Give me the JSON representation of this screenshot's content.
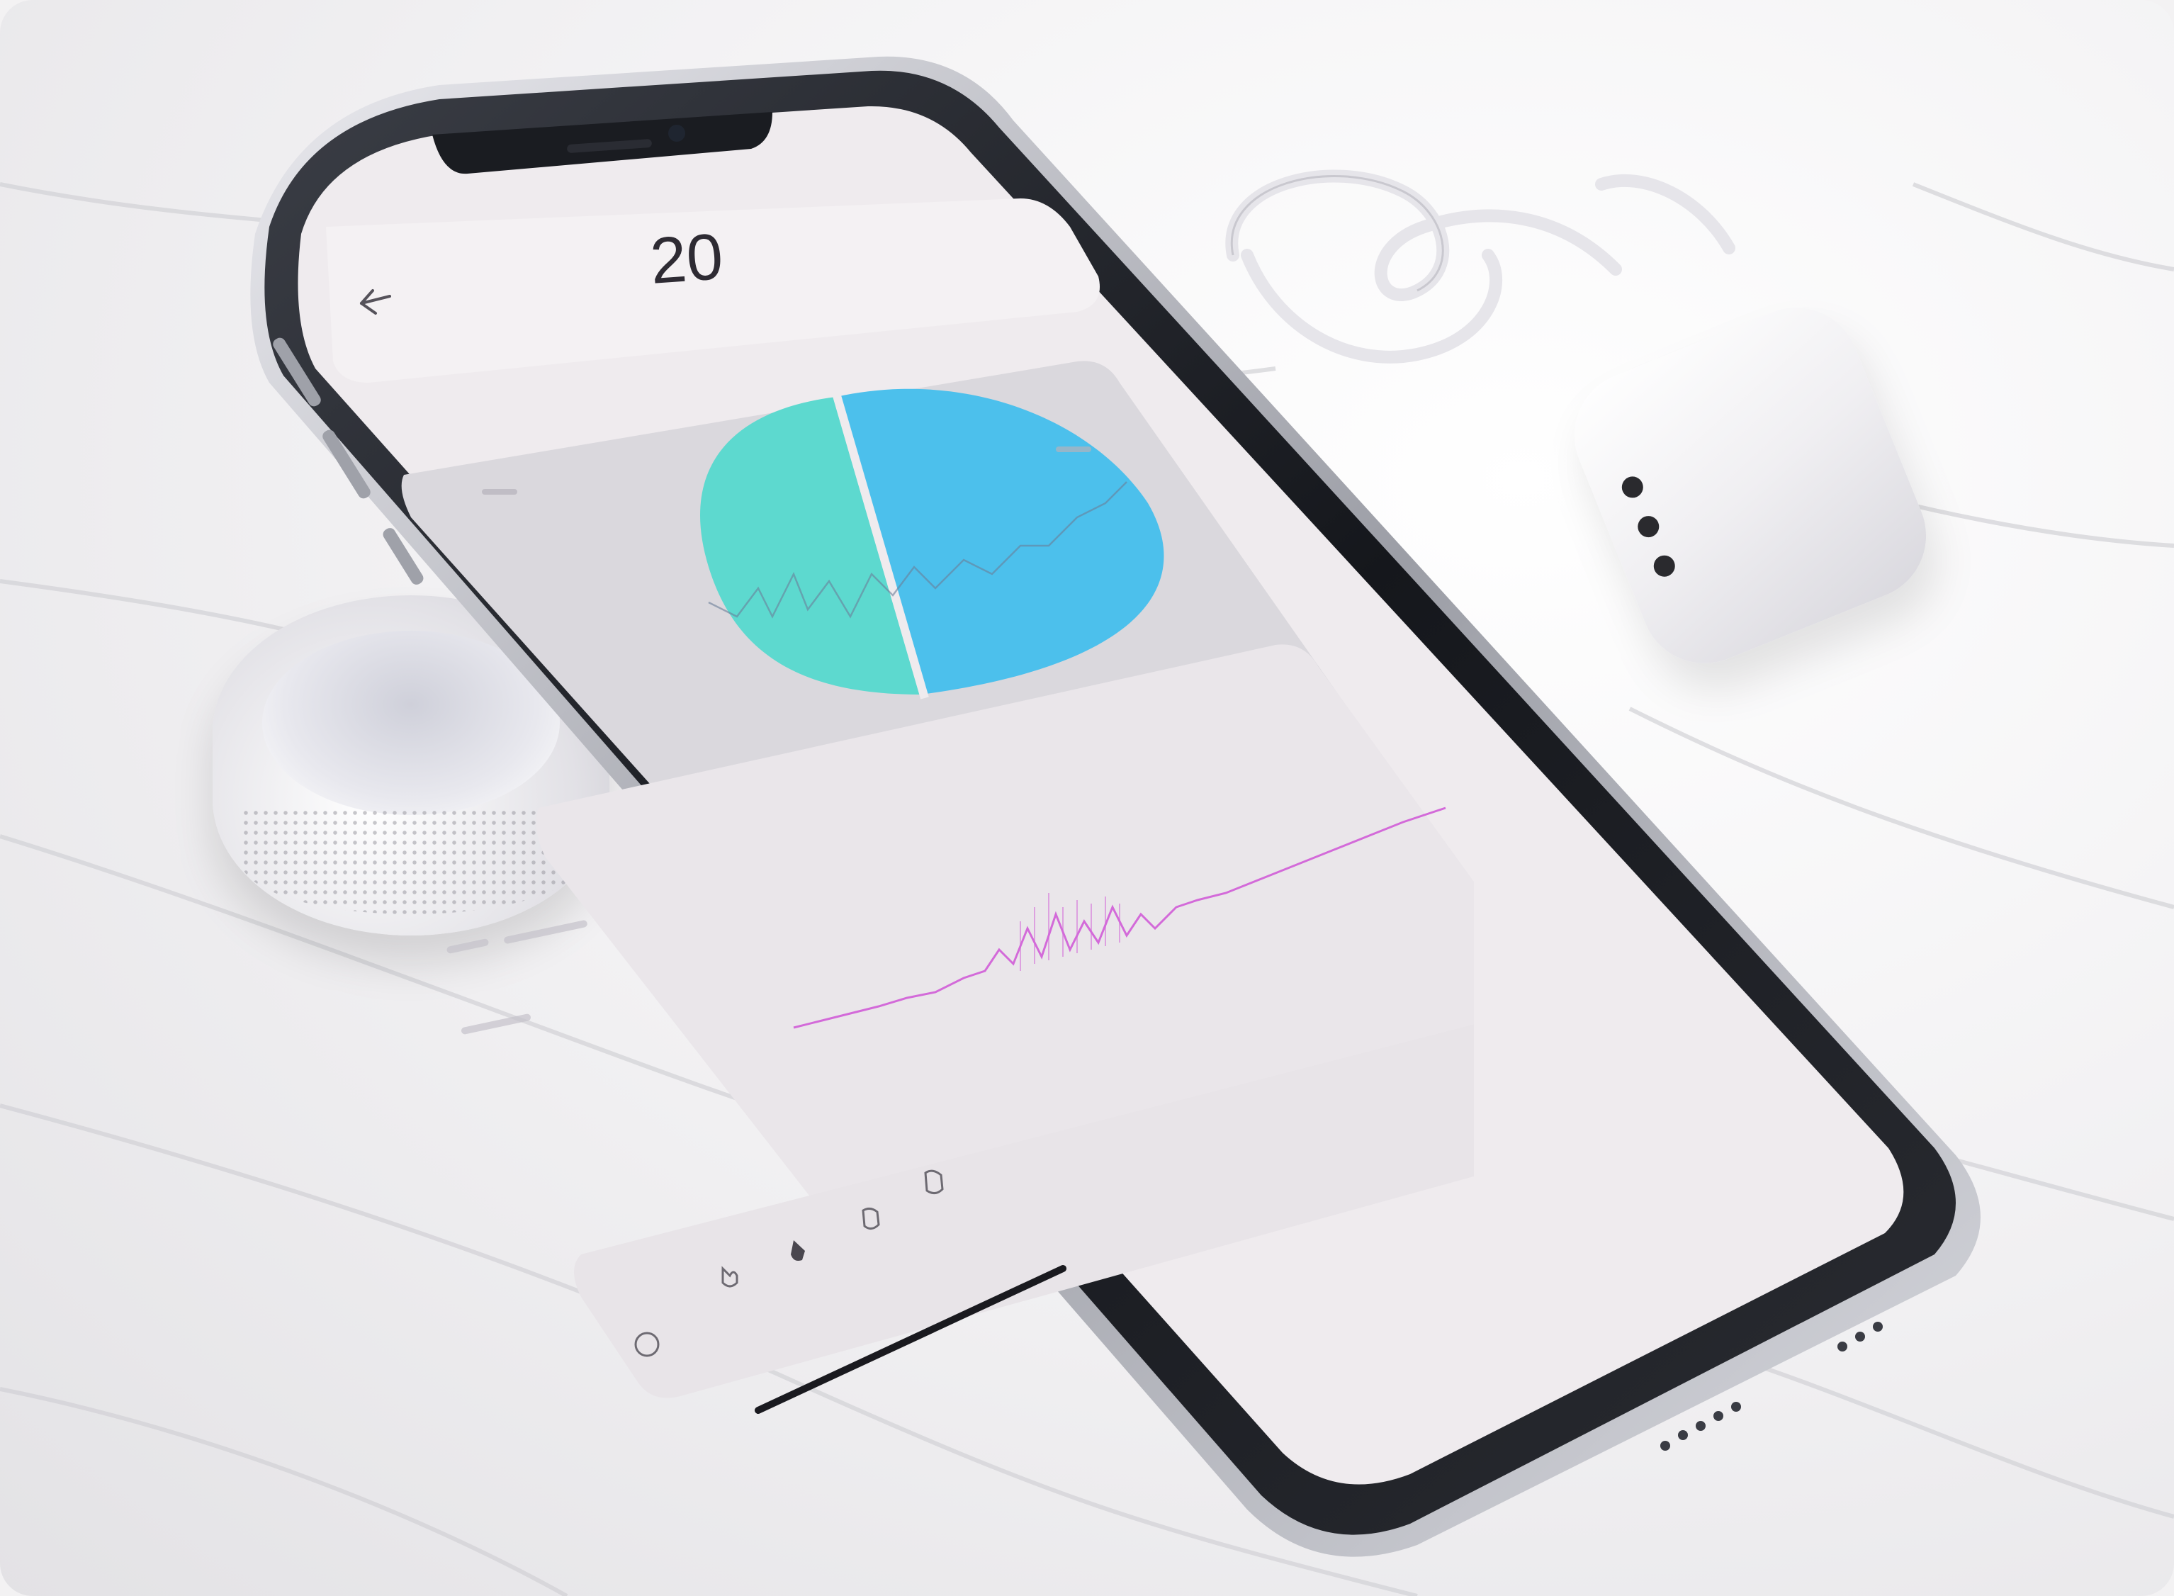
{
  "screen": {
    "header_value": "20",
    "back_icon": "arrow-left-icon",
    "nav_icons": [
      "circle-icon",
      "hand-icon",
      "pointer-icon",
      "tag-icon",
      "tag-icon"
    ]
  },
  "chart_data": {
    "type": "pie",
    "values": [
      50,
      50
    ],
    "colors": [
      "#5dd9cf",
      "#4cc0ec"
    ]
  },
  "colors": {
    "pie_left": "#5dd9cf",
    "pie_right": "#4cc0ec",
    "waveform": "#d36ad9",
    "screen_bg": "#efebee",
    "phone_frame": "#1c1e24"
  }
}
